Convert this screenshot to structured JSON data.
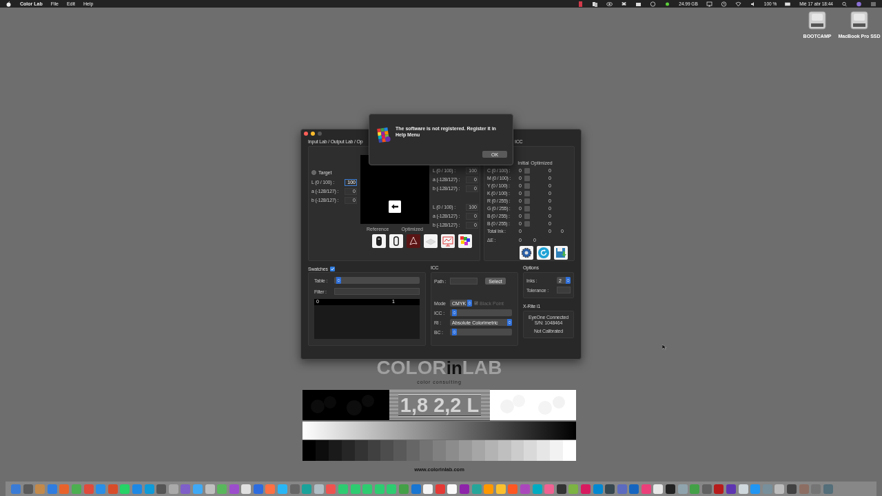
{
  "menubar": {
    "app_name": "Color Lab",
    "menus": [
      "File",
      "Edit",
      "Help"
    ],
    "disk": "24.99 GB",
    "battery": "100 %",
    "clock": "Mié 17 abr 18:44"
  },
  "desktop_icons": [
    {
      "label": "BOOTCAMP"
    },
    {
      "label": "MacBook Pro SSD"
    }
  ],
  "window": {
    "lab_panel": {
      "title": "Input Lab / Output Lab / Op",
      "target": {
        "label": "Target",
        "selected": false
      },
      "target_fields": [
        {
          "label": "L (0 / 100) :",
          "value": "100",
          "focused": true
        },
        {
          "label": "a (-128/127) :",
          "value": "0",
          "focused": false
        },
        {
          "label": "b (-128/127) :",
          "value": "0",
          "focused": false
        }
      ],
      "input_fields": [
        {
          "label": "L (0 / 100) :",
          "value": "100"
        },
        {
          "label": "a (-128/127) :",
          "value": "0"
        },
        {
          "label": "b (-128/127) :",
          "value": "0"
        }
      ],
      "output_fields": [
        {
          "label": "L (0 / 100) :",
          "value": "100"
        },
        {
          "label": "a (-128/127) :",
          "value": "0"
        },
        {
          "label": "b (-128/127) :",
          "value": "0"
        }
      ],
      "preview_labels": [
        "Reference",
        "Optimized"
      ]
    },
    "icc_panel": {
      "title": "ICC",
      "columns": [
        "Initial",
        "Optimized"
      ],
      "rows": [
        {
          "label": "C (0 / 100) :",
          "initial": "0",
          "checked": false,
          "optimized": "0"
        },
        {
          "label": "M (0 / 100) :",
          "initial": "0",
          "checked": false,
          "optimized": "0"
        },
        {
          "label": "Y (0 / 100) :",
          "initial": "0",
          "checked": false,
          "optimized": "0"
        },
        {
          "label": "K (0 / 100) :",
          "initial": "0",
          "checked": false,
          "optimized": "0"
        },
        {
          "label": "R (0 / 255) :",
          "initial": "0",
          "checked": false,
          "optimized": "0"
        },
        {
          "label": "G (0 / 255) :",
          "initial": "0",
          "checked": false,
          "optimized": "0"
        },
        {
          "label": "B (0 / 255) :",
          "initial": "0",
          "checked": false,
          "optimized": "0"
        },
        {
          "label": "B (0 / 255) :",
          "initial": "0",
          "checked": false,
          "optimized": "0"
        }
      ],
      "total_ink": {
        "label": "Total Ink :",
        "values": [
          "0",
          "0",
          "0"
        ]
      },
      "delta_e": {
        "label": "ΔE :",
        "values": [
          "0",
          "0"
        ]
      }
    },
    "swatches": {
      "title": "Swatches",
      "enabled": true,
      "table_label": "Table :",
      "filter_label": "Filter :",
      "list_columns": [
        "0",
        "1"
      ]
    },
    "icc": {
      "title": "ICC",
      "path_label": "Path :",
      "select_button": "Select",
      "mode_label": "Mode",
      "mode": "CMYK",
      "black_point": {
        "label": "Black Point",
        "checked": true,
        "disabled": true
      },
      "icc_label": "ICC :",
      "ri_label": "RI :",
      "ri": "Absolute Colorimetric",
      "bc_label": "BC :"
    },
    "options": {
      "title": "Options",
      "inks_label": "Inks :",
      "inks": "2",
      "tolerance_label": "Tolerance :"
    },
    "xrite": {
      "title": "X-Rite i1",
      "lines": [
        "EyeOne Connected",
        "S/N: 1048464"
      ],
      "status": "Not Calibrated"
    }
  },
  "dialog": {
    "message": "The software is not registered. Register it in Help Menu",
    "button": "OK"
  },
  "test_chart": {
    "logo": [
      "COLOR",
      "in",
      "LAB"
    ],
    "tagline": "color consulting",
    "gamma_text": "1,8 2,2 L",
    "url": "www.colorinlab.com"
  }
}
